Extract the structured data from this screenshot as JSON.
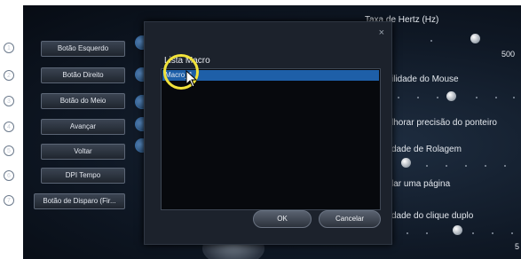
{
  "left_buttons": [
    {
      "label": "Botão Esquerdo"
    },
    {
      "label": "Botão Direito"
    },
    {
      "label": "Botão do Meio"
    },
    {
      "label": "Avançar"
    },
    {
      "label": "Voltar"
    },
    {
      "label": "DPI Tempo"
    },
    {
      "label": "Botão de Disparo (Fir..."
    }
  ],
  "dialog": {
    "close_icon": "×",
    "title": "Lista Macro",
    "list_items": [
      "Macro_1"
    ],
    "ok_label": "OK",
    "cancel_label": "Cancelar"
  },
  "right_panel": {
    "hertz_label": "Taxa de Hertz (Hz)",
    "hertz_value": "500",
    "sensitivity_label": "ilidade do Mouse",
    "precision_label": "lhorar precisão do ponteiro",
    "scroll_label": "dade de Rolagem",
    "page_label": "lar uma página",
    "dblclick_label": "dade do clique duplo",
    "bottom_value": "5"
  },
  "colors": {
    "selection": "#1e5fa8",
    "highlight_ring": "#f1e23a",
    "background": "#0f1825"
  }
}
